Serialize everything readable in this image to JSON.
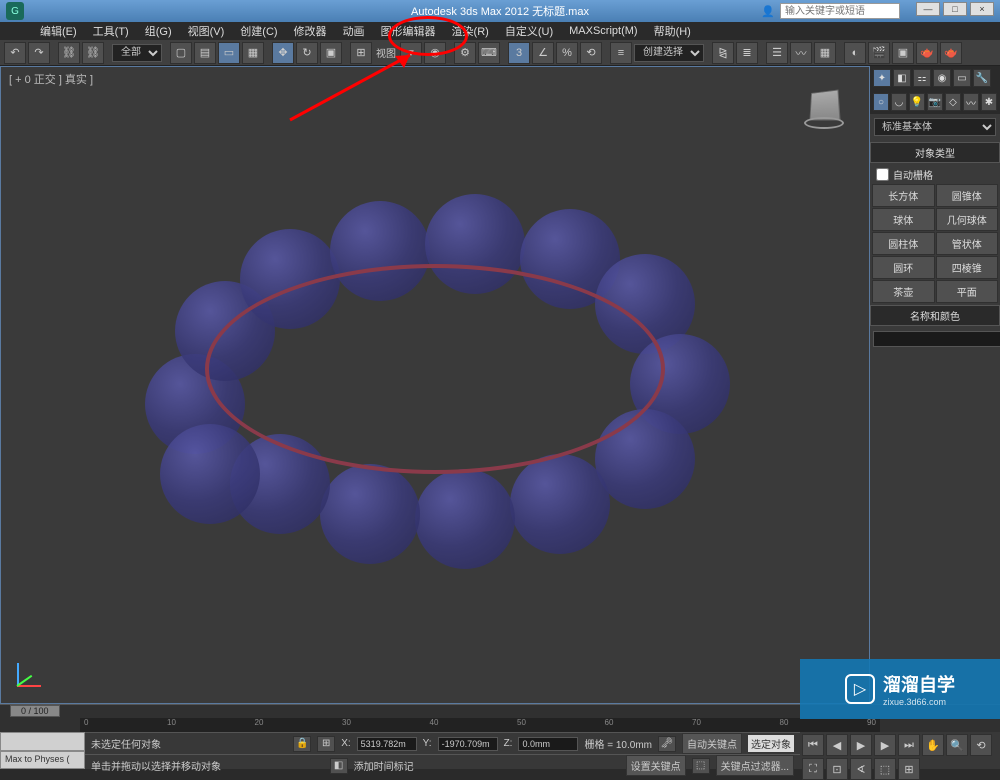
{
  "titlebar": {
    "title": "Autodesk 3ds Max  2012    无标题.max",
    "search_placeholder": "输入关键字或短语",
    "min": "—",
    "max": "□",
    "close": "×"
  },
  "menu": [
    "编辑(E)",
    "工具(T)",
    "组(G)",
    "视图(V)",
    "创建(C)",
    "修改器",
    "动画",
    "图形编辑器",
    "渲染(R)",
    "自定义(U)",
    "MAXScript(M)",
    "帮助(H)"
  ],
  "toolbar1": {
    "all_dropdown": "全部",
    "view_label": "视图",
    "selection_set": "创建选择集"
  },
  "viewport": {
    "label": "[ + 0 正交 ] 真实 ]"
  },
  "panel": {
    "primitive_dropdown": "标准基本体",
    "rollout_type": "对象类型",
    "autogrid": "自动栅格",
    "buttons": [
      "长方体",
      "圆锥体",
      "球体",
      "几何球体",
      "圆柱体",
      "管状体",
      "圆环",
      "四棱锥",
      "茶壶",
      "平面"
    ],
    "rollout_name": "名称和颜色"
  },
  "timeline": {
    "slider": "0 / 100",
    "ticks": [
      "0",
      "10",
      "20",
      "30",
      "40",
      "50",
      "60",
      "70",
      "80",
      "90"
    ]
  },
  "status": {
    "maxscript": "Max to Physes (",
    "no_select": "未选定任何对象",
    "hint": "单击并拖动以选择并移动对象",
    "x": "5319.782m",
    "y": "-1970.709m",
    "z": "0.0mm",
    "x_label": "X:",
    "y_label": "Y:",
    "z_label": "Z:",
    "grid": "栅格 = 10.0mm",
    "add_time_tag": "添加时间标记",
    "auto_key": "自动关键点",
    "set_key": "设置关键点",
    "selected": "选定对象",
    "key_filter": "关键点过滤器..."
  },
  "watermark": {
    "big": "溜溜自学",
    "small": "zixue.3d66.com"
  }
}
